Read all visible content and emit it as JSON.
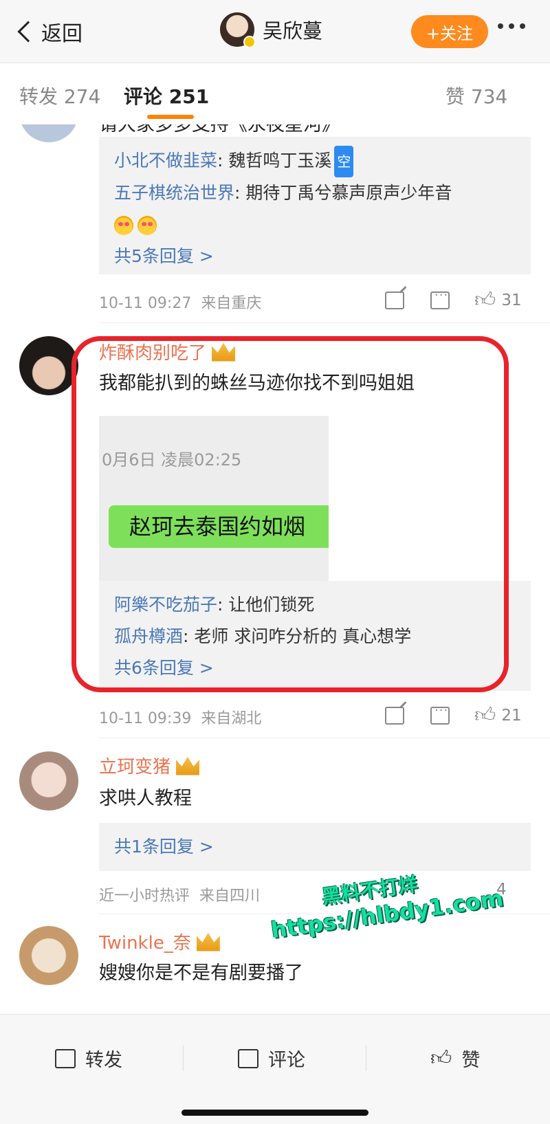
{
  "header": {
    "back_label": "返回",
    "user_name": "吴欣蔓",
    "follow_label": "+关注",
    "more_icon": "more-dots-icon"
  },
  "tabs": [
    {
      "label": "转发 274"
    },
    {
      "label": "评论 251"
    },
    {
      "label": "赞 734"
    }
  ],
  "comment0": {
    "partial_text": "请大家多多支持《永夜星河》",
    "replies": [
      {
        "user": "小北不做韭菜",
        "text": ": 魏哲鸣丁玉溪",
        "badge": "空"
      },
      {
        "user": "五子棋统治世界",
        "text": ": 期待丁禹兮慕声原声少年音"
      }
    ],
    "more_replies": "共5条回复 >",
    "time": "10-11 09:27",
    "location": "来自重庆",
    "likes": "31"
  },
  "comment1": {
    "user": "炸酥肉别吃了",
    "text": "我都能扒到的蛛丝马迹你找不到吗姐姐",
    "image": {
      "time": "0月6日 凌晨02:25",
      "bubble": "赵珂去泰国约如烟"
    },
    "replies": [
      {
        "user": "阿樂不吃茄子",
        "text": ": 让他们锁死"
      },
      {
        "user": "孤舟樽酒",
        "text": ": 老师 求问咋分析的 真心想学"
      }
    ],
    "more_replies": "共6条回复 >",
    "time": "10-11 09:39",
    "location": "来自湖北",
    "likes": "21"
  },
  "comment2": {
    "user": "立珂变猪",
    "text": "求哄人教程",
    "more_replies": "共1条回复 >",
    "time": "近一小时热评",
    "location": "来自四川",
    "likes": "4"
  },
  "comment3": {
    "user": "Twinkle_奈",
    "partial_text": "嫂嫂你是不是有剧要播了"
  },
  "watermark": {
    "line1": "黑料不打烊",
    "line2": "https://hlbdy1.com"
  },
  "bottom": {
    "repost": "转发",
    "comment": "评论",
    "like": "赞"
  },
  "colors": {
    "accent": "#ff8200",
    "username": "#eb7350",
    "link": "#4a78b8",
    "highlight": "#e8232b"
  }
}
